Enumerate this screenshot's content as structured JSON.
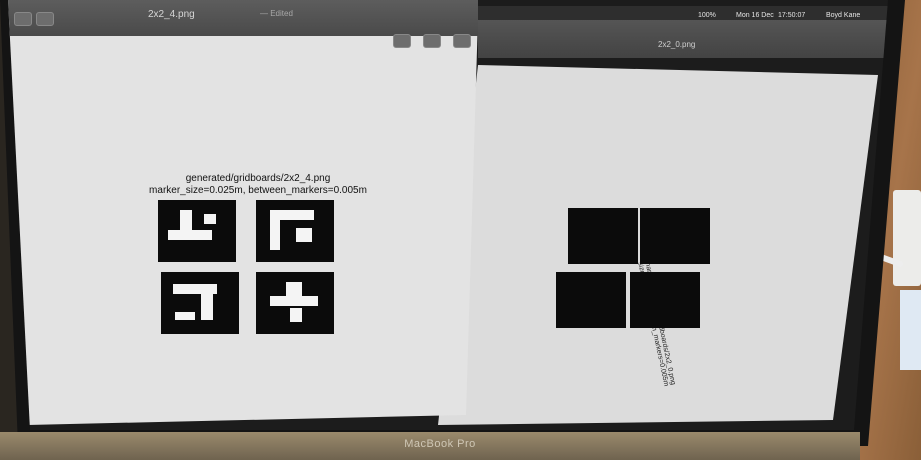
{
  "left_window": {
    "title": "2x2_4.png",
    "subtitle": "— Edited",
    "caption_line1": "generated/gridboards/2x2_4.png",
    "caption_line2": "marker_size=0.025m, between_markers=0.005m"
  },
  "right_window": {
    "title": "2x2_0.png",
    "caption_line1": "marker: generated/gridboards/2x2_0.png",
    "caption_line2": "size=0.025m, between_markers=0.005m"
  },
  "menubar": {
    "battery": "100%",
    "date": "Mon 16 Dec",
    "time": "17:50:07",
    "user": "Boyd Kane"
  },
  "device": {
    "brand": "MacBook Pro"
  },
  "colors": {
    "screen_bg": "#e3e3e3",
    "marker": "#0b0b0b",
    "bezel": "#141414",
    "desk": "#8a5f38"
  }
}
